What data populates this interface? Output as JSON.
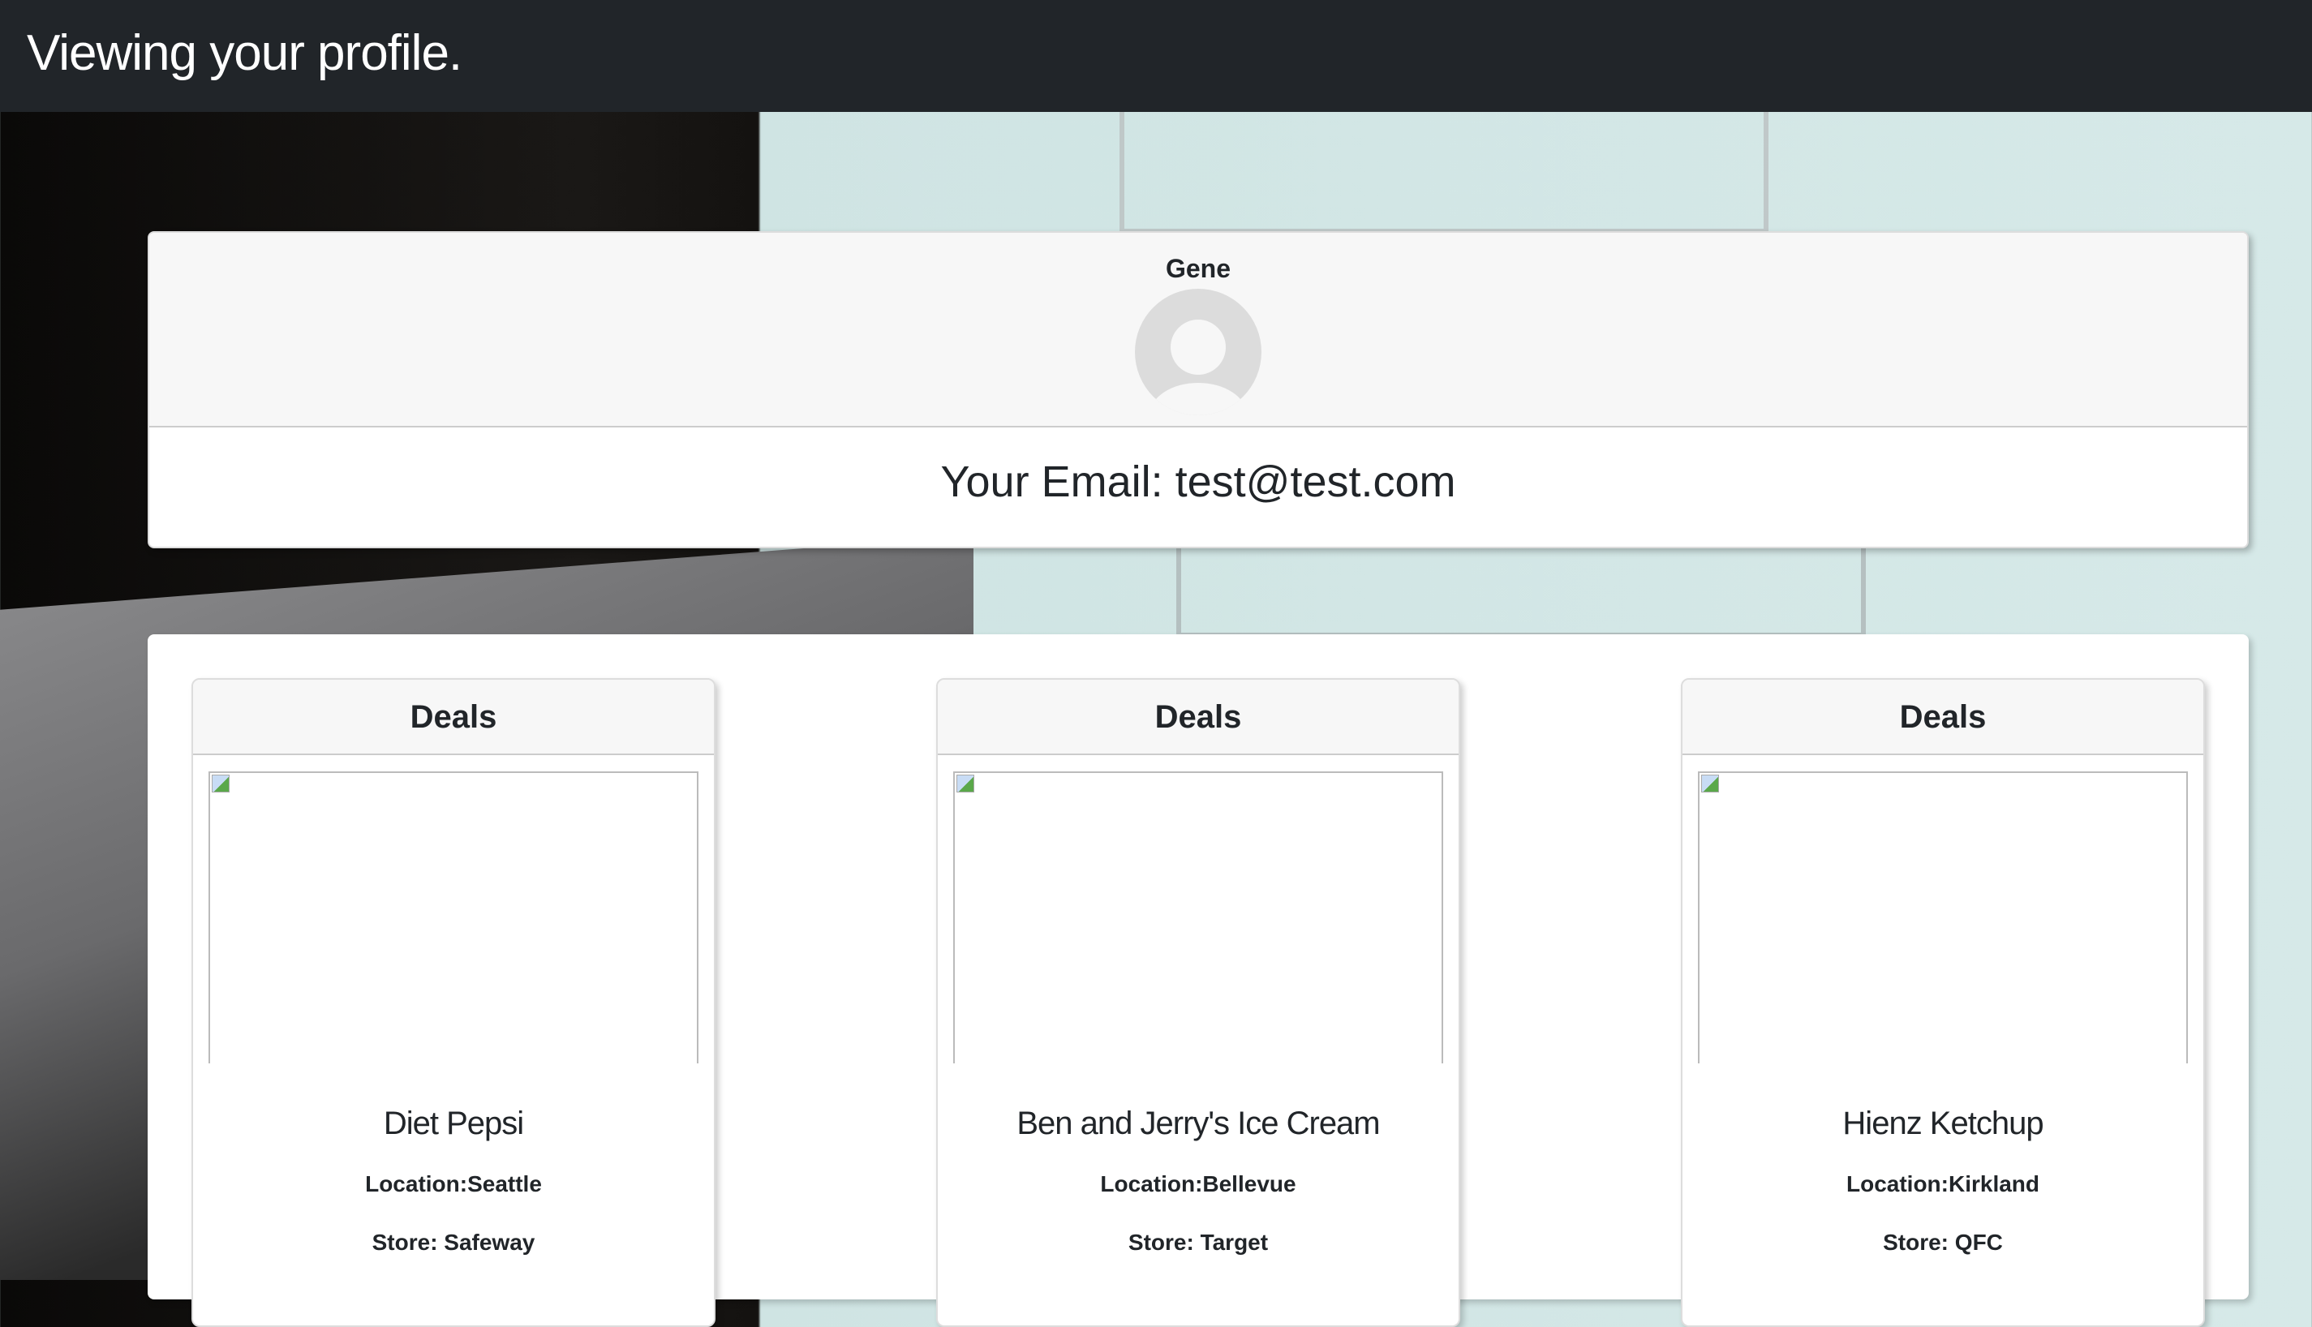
{
  "header": {
    "title": "Viewing your profile."
  },
  "profile": {
    "name": "Gene",
    "email_line": "Your Email: test@test.com"
  },
  "deals": [
    {
      "header": "Deals",
      "title": "Diet Pepsi",
      "location": "Location:Seattle",
      "store": "Store: Safeway"
    },
    {
      "header": "Deals",
      "title": "Ben and Jerry's Ice Cream",
      "location": "Location:Bellevue",
      "store": "Store: Target"
    },
    {
      "header": "Deals",
      "title": "Hienz Ketchup",
      "location": "Location:Kirkland",
      "store": "Store: QFC"
    }
  ]
}
